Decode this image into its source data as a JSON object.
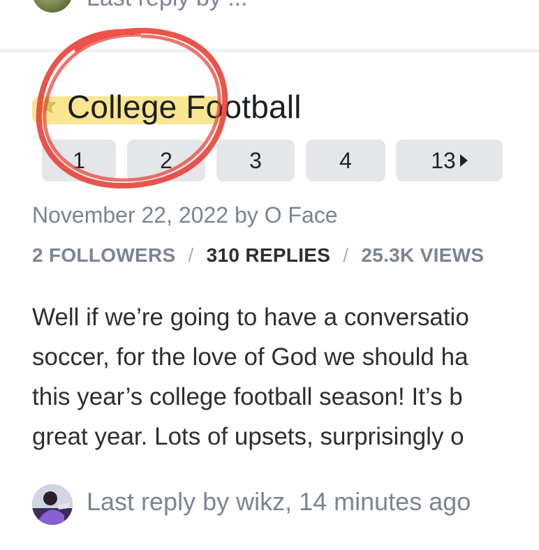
{
  "previous_topic": {
    "fragment": "Last reply by ..."
  },
  "topic": {
    "title": "College Football",
    "pages": [
      "1",
      "2",
      "3",
      "4",
      "13"
    ],
    "date": "November 22, 2022",
    "by_word": "by",
    "author": "O Face",
    "followers": "2 FOLLOWERS",
    "replies": "310 REPLIES",
    "views": "25.3K VIEWS",
    "separator": "/",
    "body_lines": [
      "Well if we’re going to have a conversatio",
      "soccer, for the love of God we should ha",
      "this year’s college football season! It’s b",
      "great year. Lots of upsets, surprisingly o"
    ],
    "last_reply": "Last reply by wikz, 14 minutes ago"
  },
  "colors": {
    "highlight": "#f7e27c",
    "annotation": "#e8453c",
    "page_button": "#e4e6e9",
    "muted_text": "#7a8493"
  },
  "icons": {
    "favorite": "star-icon",
    "last_page": "caret-right-icon"
  }
}
